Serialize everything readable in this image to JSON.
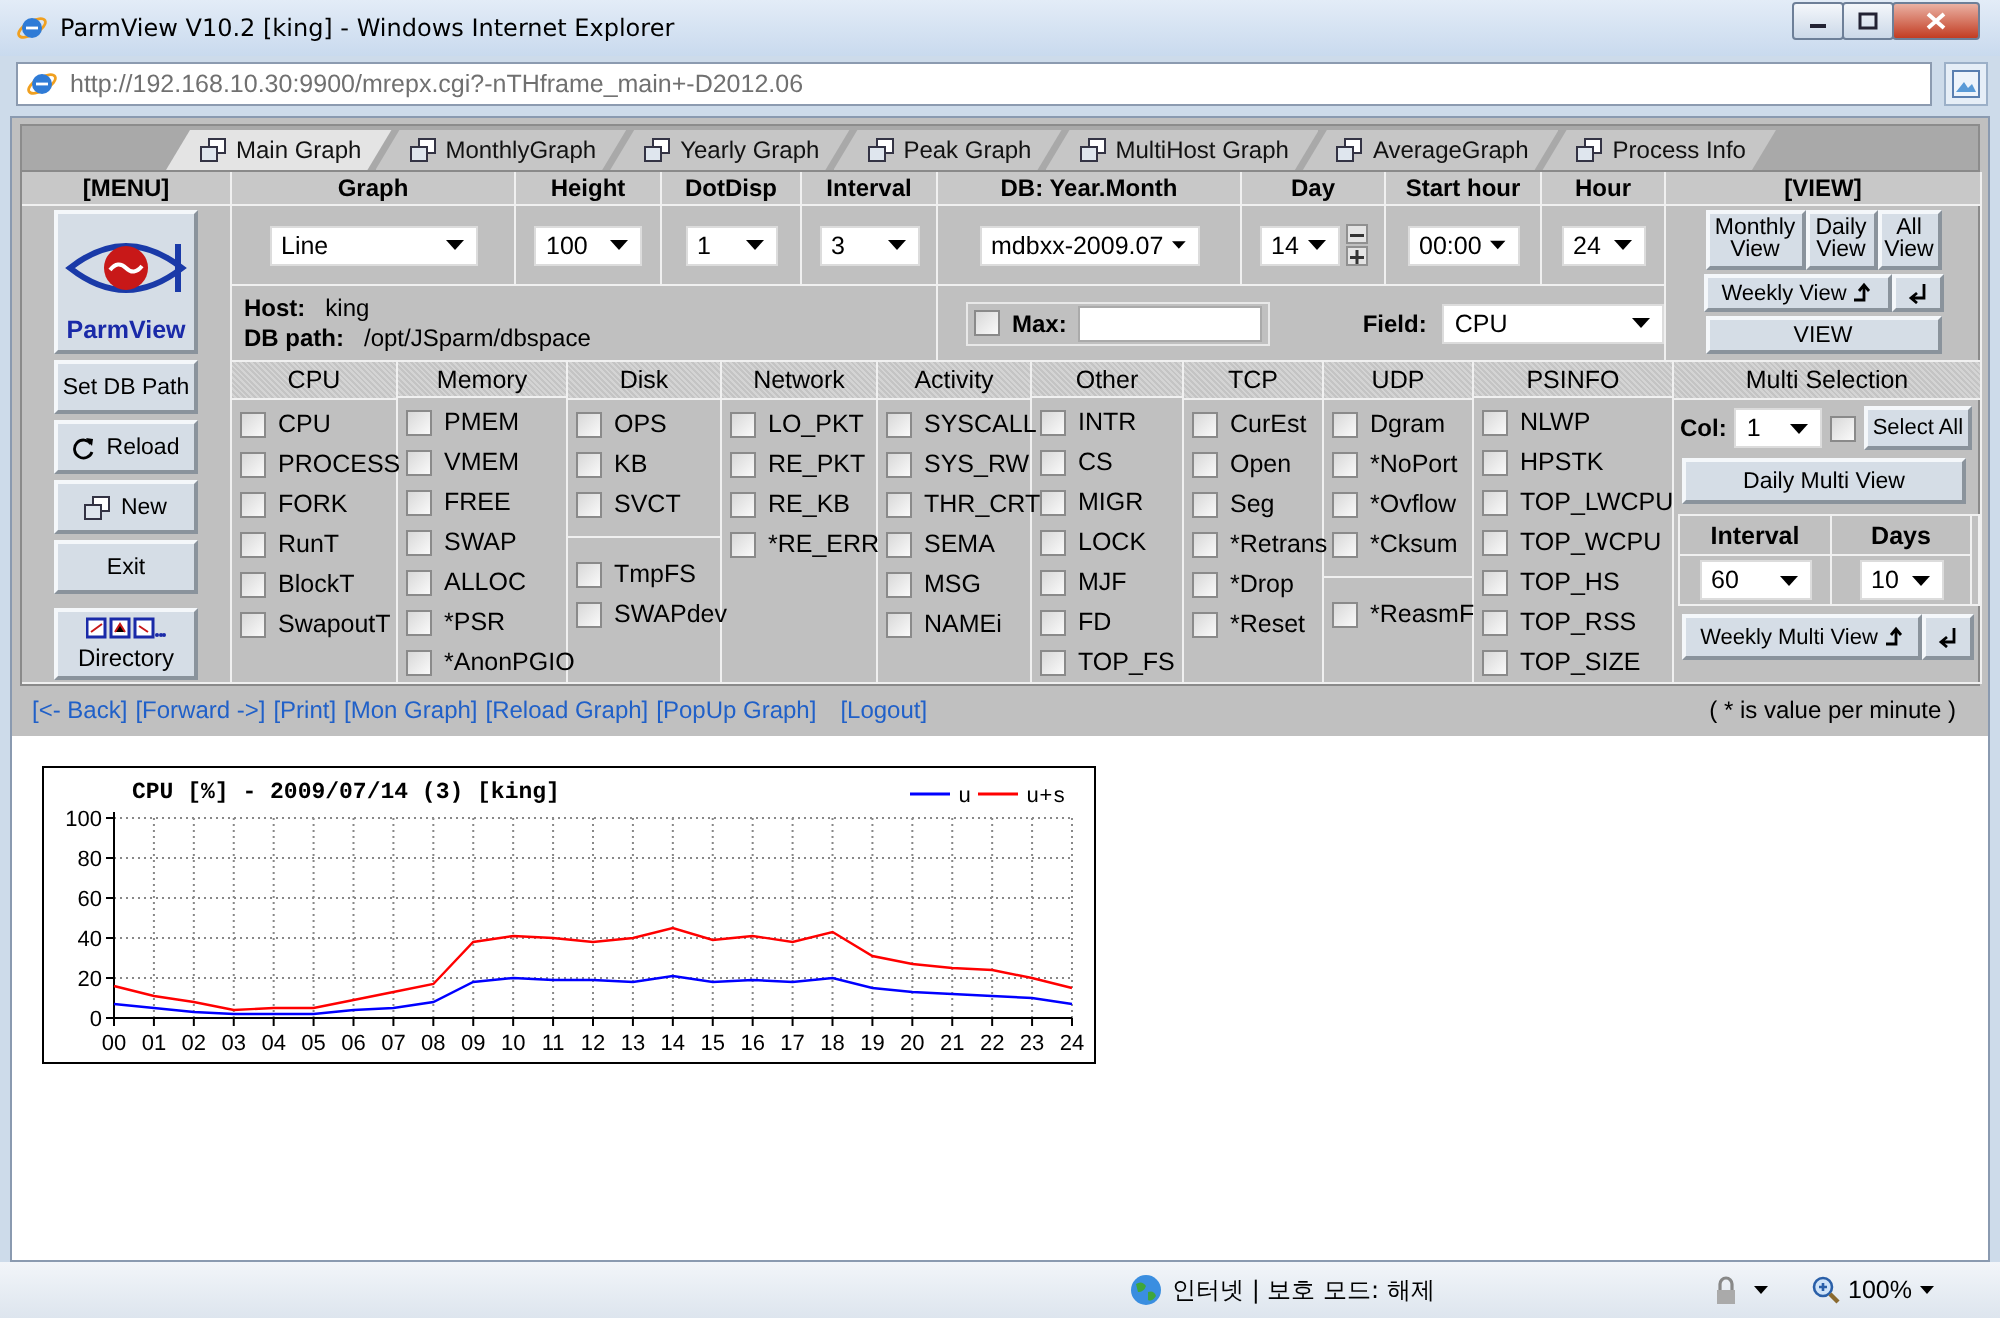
{
  "window": {
    "title": "ParmView V10.2 [king] - Windows Internet Explorer",
    "address": "http://192.168.10.30:9900/mrepx.cgi?-nTHframe_main+-D2012.06"
  },
  "tabs": [
    {
      "label": "Main Graph",
      "selected": true
    },
    {
      "label": "MonthlyGraph",
      "selected": false
    },
    {
      "label": "Yearly Graph",
      "selected": false
    },
    {
      "label": "Peak Graph",
      "selected": false
    },
    {
      "label": "MultiHost Graph",
      "selected": false
    },
    {
      "label": "AverageGraph",
      "selected": false
    },
    {
      "label": "Process Info",
      "selected": false
    }
  ],
  "menu": {
    "header": "[MENU]",
    "logo_label": "ParmView",
    "buttons": [
      {
        "kind": "text",
        "label": "Set DB Path"
      },
      {
        "kind": "reload",
        "label": "Reload"
      },
      {
        "kind": "new",
        "label": "New"
      },
      {
        "kind": "text",
        "label": "Exit"
      }
    ],
    "directory_label": "Directory"
  },
  "settings": [
    {
      "header": "Graph",
      "value": "Line"
    },
    {
      "header": "Height",
      "value": "100"
    },
    {
      "header": "DotDisp",
      "value": "1"
    },
    {
      "header": "Interval",
      "value": "3"
    },
    {
      "header": "DB: Year.Month",
      "value": "mdbxx-2009.07"
    },
    {
      "header": "Day",
      "value": "14",
      "stepper": true
    },
    {
      "header": "Start hour",
      "value": "00:00"
    },
    {
      "header": "Hour",
      "value": "24"
    }
  ],
  "info": {
    "host_label": "Host:",
    "host": "king",
    "path_label": "DB path:",
    "path": "/opt/JSparm/dbspace"
  },
  "max": {
    "checked": false,
    "label": "Max:"
  },
  "field": {
    "label": "Field:",
    "value": "CPU"
  },
  "view": {
    "header": "[VIEW]",
    "buttons": [
      "Monthly View",
      "Daily View",
      "All View"
    ],
    "weekly": "Weekly View",
    "view_button": "VIEW"
  },
  "categories": [
    {
      "title": "CPU",
      "sections": [
        [
          {
            "label": "CPU",
            "checked": false
          },
          {
            "label": "PROCESS",
            "checked": false
          },
          {
            "label": "FORK",
            "checked": false
          },
          {
            "label": "RunT",
            "checked": false
          },
          {
            "label": "BlockT",
            "checked": false
          },
          {
            "label": "SwapoutT",
            "checked": false
          }
        ]
      ]
    },
    {
      "title": "Memory",
      "sections": [
        [
          {
            "label": "PMEM",
            "checked": false
          },
          {
            "label": "VMEM",
            "checked": false
          },
          {
            "label": "FREE",
            "checked": false
          },
          {
            "label": "SWAP",
            "checked": false
          },
          {
            "label": "ALLOC",
            "checked": false
          },
          {
            "label": "*PSR",
            "checked": false
          },
          {
            "label": "*AnonPGIO",
            "checked": false
          }
        ]
      ]
    },
    {
      "title": "Disk",
      "sections": [
        [
          {
            "label": "OPS",
            "checked": false
          },
          {
            "label": "KB",
            "checked": false
          },
          {
            "label": "SVCT",
            "checked": false
          }
        ],
        [
          {
            "label": "TmpFS",
            "checked": false
          },
          {
            "label": "SWAPdev",
            "checked": false
          }
        ]
      ]
    },
    {
      "title": "Network",
      "sections": [
        [
          {
            "label": "LO_PKT",
            "checked": false
          },
          {
            "label": "RE_PKT",
            "checked": false
          },
          {
            "label": "RE_KB",
            "checked": false
          },
          {
            "label": "*RE_ERR",
            "checked": false
          }
        ]
      ]
    },
    {
      "title": "Activity",
      "sections": [
        [
          {
            "label": "SYSCALL",
            "checked": false
          },
          {
            "label": "SYS_RW",
            "checked": false
          },
          {
            "label": "THR_CRT",
            "checked": false
          },
          {
            "label": "SEMA",
            "checked": false
          },
          {
            "label": "MSG",
            "checked": false
          },
          {
            "label": "NAMEi",
            "checked": false
          }
        ]
      ]
    },
    {
      "title": "Other",
      "sections": [
        [
          {
            "label": "INTR",
            "checked": false
          },
          {
            "label": "CS",
            "checked": false
          },
          {
            "label": "MIGR",
            "checked": false
          },
          {
            "label": "LOCK",
            "checked": false
          },
          {
            "label": "MJF",
            "checked": false
          },
          {
            "label": "FD",
            "checked": false
          },
          {
            "label": "TOP_FS",
            "checked": false
          }
        ]
      ]
    },
    {
      "title": "TCP",
      "sections": [
        [
          {
            "label": "CurEst",
            "checked": false
          },
          {
            "label": "Open",
            "checked": false
          },
          {
            "label": "Seg",
            "checked": false
          },
          {
            "label": "*Retrans",
            "checked": false
          },
          {
            "label": "*Drop",
            "checked": false
          },
          {
            "label": "*Reset",
            "checked": false
          }
        ]
      ]
    },
    {
      "title": "UDP",
      "sections": [
        [
          {
            "label": "Dgram",
            "checked": false
          },
          {
            "label": "*NoPort",
            "checked": false
          },
          {
            "label": "*Ovflow",
            "checked": false
          },
          {
            "label": "*Cksum",
            "checked": false
          }
        ],
        [
          {
            "label": "*ReasmF",
            "checked": false
          }
        ]
      ]
    },
    {
      "title": "PSINFO",
      "sections": [
        [
          {
            "label": "NLWP",
            "checked": false
          },
          {
            "label": "HPSTK",
            "checked": false
          },
          {
            "label": "TOP_LWCPU",
            "checked": false
          },
          {
            "label": "TOP_WCPU",
            "checked": false
          },
          {
            "label": "TOP_HS",
            "checked": false
          },
          {
            "label": "TOP_RSS",
            "checked": false
          },
          {
            "label": "TOP_SIZE",
            "checked": false
          }
        ]
      ]
    }
  ],
  "multi": {
    "title": "Multi Selection",
    "col_label": "Col:",
    "col_value": "1",
    "select_all_checked": false,
    "select_all": "Select All",
    "daily": "Daily Multi View",
    "interval_header": "Interval",
    "days_header": "Days",
    "interval_value": "60",
    "days_value": "10",
    "weekly": "Weekly Multi View"
  },
  "nav": {
    "links": [
      "[<- Back]",
      "[Forward ->]",
      "[Print]",
      "[Mon Graph]",
      "[Reload Graph]",
      "[PopUp Graph]",
      "[Logout]"
    ],
    "note": "( * is value per minute )"
  },
  "graph": {
    "chart_data": {
      "type": "line",
      "title": "CPU [%] - 2009/07/14 (3) [king]",
      "x": [
        0,
        1,
        2,
        3,
        4,
        5,
        6,
        7,
        8,
        9,
        10,
        11,
        12,
        13,
        14,
        15,
        16,
        17,
        18,
        19,
        20,
        21,
        22,
        23,
        24
      ],
      "series": [
        {
          "name": "u",
          "color": "#0000ff",
          "values": [
            7,
            5,
            3,
            2,
            2,
            2,
            4,
            5,
            8,
            18,
            20,
            19,
            19,
            18,
            21,
            18,
            19,
            18,
            20,
            15,
            13,
            12,
            11,
            10,
            7
          ]
        },
        {
          "name": "u+s",
          "color": "#ff0000",
          "values": [
            16,
            11,
            8,
            4,
            5,
            5,
            9,
            13,
            17,
            38,
            41,
            40,
            38,
            40,
            45,
            39,
            41,
            38,
            43,
            31,
            27,
            25,
            24,
            20,
            15
          ]
        }
      ],
      "xlim": [
        0,
        24
      ],
      "ylim": [
        0,
        100
      ],
      "xticks": [
        {
          "value": 0,
          "label": "00"
        },
        {
          "value": 1,
          "label": "01"
        },
        {
          "value": 2,
          "label": "02"
        },
        {
          "value": 3,
          "label": "03"
        },
        {
          "value": 4,
          "label": "04"
        },
        {
          "value": 5,
          "label": "05"
        },
        {
          "value": 6,
          "label": "06"
        },
        {
          "value": 7,
          "label": "07"
        },
        {
          "value": 8,
          "label": "08"
        },
        {
          "value": 9,
          "label": "09"
        },
        {
          "value": 10,
          "label": "10"
        },
        {
          "value": 11,
          "label": "11"
        },
        {
          "value": 12,
          "label": "12"
        },
        {
          "value": 13,
          "label": "13"
        },
        {
          "value": 14,
          "label": "14"
        },
        {
          "value": 15,
          "label": "15"
        },
        {
          "value": 16,
          "label": "16"
        },
        {
          "value": 17,
          "label": "17"
        },
        {
          "value": 18,
          "label": "18"
        },
        {
          "value": 19,
          "label": "19"
        },
        {
          "value": 20,
          "label": "20"
        },
        {
          "value": 21,
          "label": "21"
        },
        {
          "value": 22,
          "label": "22"
        },
        {
          "value": 23,
          "label": "23"
        },
        {
          "value": 24,
          "label": "24"
        }
      ],
      "yticks": [
        {
          "value": 0,
          "label": "0"
        },
        {
          "value": 20,
          "label": "20"
        },
        {
          "value": 40,
          "label": "40"
        },
        {
          "value": 60,
          "label": "60"
        },
        {
          "value": 80,
          "label": "80"
        },
        {
          "value": 100,
          "label": "100"
        }
      ],
      "grid": true,
      "legend": true
    }
  },
  "status_bar": {
    "zone": "인터넷 | 보호 모드: 해제",
    "zoom": "100%"
  }
}
